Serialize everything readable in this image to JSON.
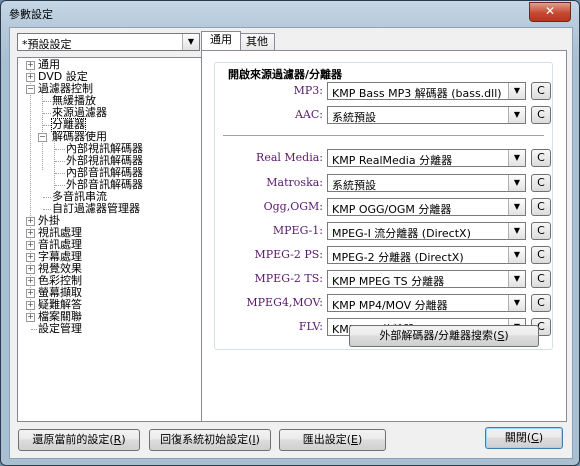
{
  "window": {
    "title": "參數設定",
    "close_glyph": "✕"
  },
  "preset": {
    "value": "*預設設定"
  },
  "tree": {
    "items": [
      {
        "label": "通用"
      },
      {
        "label": "DVD 設定"
      },
      {
        "label": "過濾器控制"
      },
      {
        "label": "無緩播放"
      },
      {
        "label": "來源過濾器"
      },
      {
        "label": "分離器"
      },
      {
        "label": "解碼器使用"
      },
      {
        "label": "內部視訊解碼器"
      },
      {
        "label": "外部視訊解碼器"
      },
      {
        "label": "內部音訊解碼器"
      },
      {
        "label": "外部音訊解碼器"
      },
      {
        "label": "多音訊串流"
      },
      {
        "label": "自訂過濾器管理器"
      },
      {
        "label": "外掛"
      },
      {
        "label": "視訊處理"
      },
      {
        "label": "音訊處理"
      },
      {
        "label": "字幕處理"
      },
      {
        "label": "視覺效果"
      },
      {
        "label": "色彩控制"
      },
      {
        "label": "螢幕擷取"
      },
      {
        "label": "疑難解答"
      },
      {
        "label": "檔案關聯"
      },
      {
        "label": "設定管理"
      }
    ]
  },
  "tabs": [
    {
      "label": "通用"
    },
    {
      "label": "其他"
    }
  ],
  "group": {
    "title": "開啟來源過濾器/分離器"
  },
  "rows": [
    {
      "label": "MP3:",
      "value": "KMP Bass MP3 解碼器 (bass.dll)",
      "btn": "C"
    },
    {
      "label": "AAC:",
      "value": "系統預設",
      "btn": "C"
    },
    {
      "label": "Real Media:",
      "value": "KMP RealMedia 分離器",
      "btn": "C"
    },
    {
      "label": "Matroska:",
      "value": "系統預設",
      "btn": "C"
    },
    {
      "label": "Ogg,OGM:",
      "value": "KMP OGG/OGM 分離器",
      "btn": "C"
    },
    {
      "label": "MPEG-1:",
      "value": "MPEG-I 流分離器 (DirectX)",
      "btn": "C"
    },
    {
      "label": "MPEG-2 PS:",
      "value": "MPEG-2 分離器 (DirectX)",
      "btn": "C"
    },
    {
      "label": "MPEG-2 TS:",
      "value": "KMP MPEG TS 分離器",
      "btn": "C"
    },
    {
      "label": "MPEG4,MOV:",
      "value": "KMP MP4/MOV 分離器",
      "btn": "C"
    },
    {
      "label": "FLV:",
      "value": "KMP FLV 分離器",
      "btn": "C"
    }
  ],
  "search_button": {
    "label": "外部解碼器/分離器搜索",
    "hotkey": "S"
  },
  "bottom": {
    "restore": {
      "label": "還原當前的設定",
      "hotkey": "R"
    },
    "reset": {
      "label": "回復系統初始設定",
      "hotkey": "I"
    },
    "export": {
      "label": "匯出設定",
      "hotkey": "E"
    },
    "close": {
      "label": "關閉",
      "hotkey": "C"
    }
  }
}
